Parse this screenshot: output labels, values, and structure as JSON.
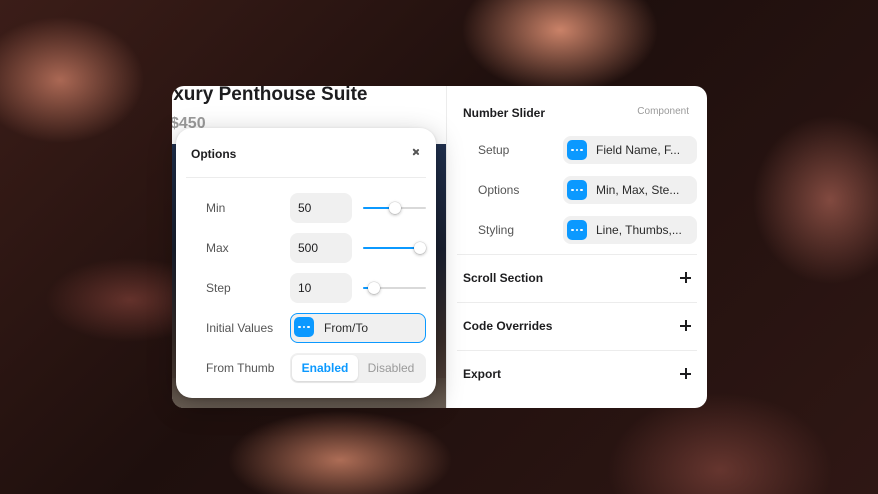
{
  "preview": {
    "title": "Luxury Penthouse Suite",
    "price": "$450"
  },
  "properties": {
    "title": "Number Slider",
    "tag": "Component",
    "rows": [
      {
        "label": "Setup",
        "value": "Field Name, F..."
      },
      {
        "label": "Options",
        "value": "Min, Max, Ste..."
      },
      {
        "label": "Styling",
        "value": "Line, Thumbs,..."
      }
    ],
    "sections": [
      {
        "label": "Scroll Section"
      },
      {
        "label": "Code Overrides"
      },
      {
        "label": "Export"
      }
    ]
  },
  "options": {
    "title": "Options",
    "min": {
      "label": "Min",
      "value": "50",
      "slider": 0.5
    },
    "max": {
      "label": "Max",
      "value": "500",
      "slider": 0.9
    },
    "step": {
      "label": "Step",
      "value": "10",
      "slider": 0.17
    },
    "initial": {
      "label": "Initial Values",
      "value": "From/To"
    },
    "from_thumb": {
      "label": "From Thumb",
      "options": [
        "Enabled",
        "Disabled"
      ],
      "selected": "Enabled"
    }
  },
  "colors": {
    "accent": "#0b99ff"
  },
  "icons": {
    "field_button": "more-dots-icon",
    "close": "close-icon",
    "expand": "plus-icon"
  }
}
